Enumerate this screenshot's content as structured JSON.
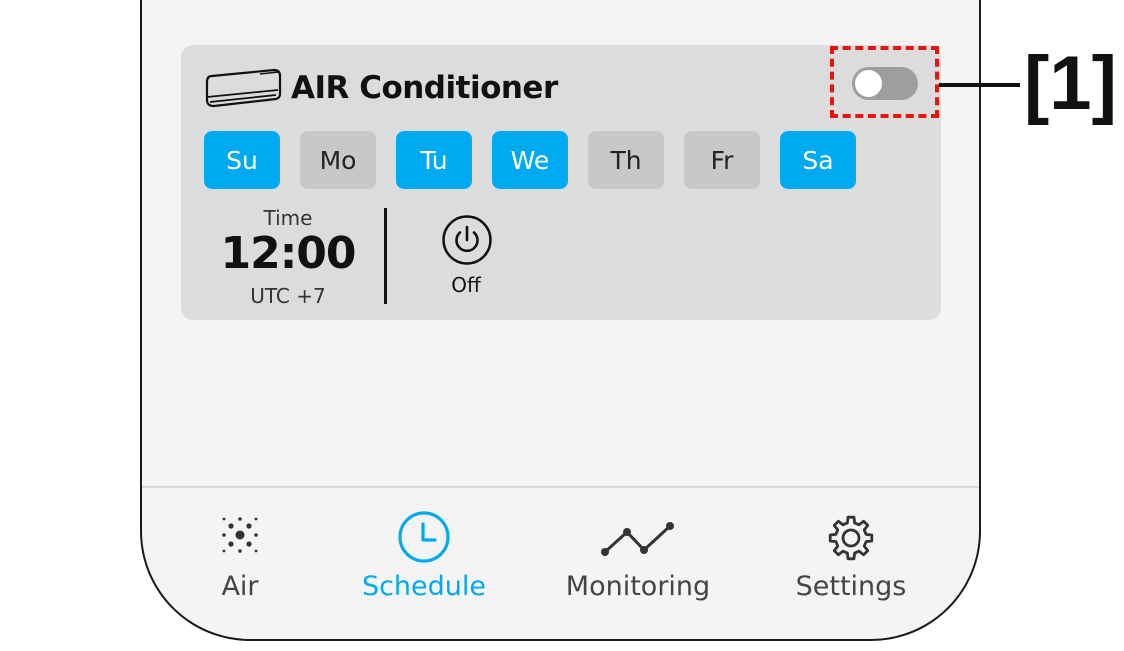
{
  "card": {
    "title": "AIR Conditioner",
    "toggle_state": "off",
    "icon": "air-conditioner-icon"
  },
  "callout": {
    "label": "[1]"
  },
  "days": [
    {
      "label": "Su",
      "active": true
    },
    {
      "label": "Mo",
      "active": false
    },
    {
      "label": "Tu",
      "active": true
    },
    {
      "label": "We",
      "active": true
    },
    {
      "label": "Th",
      "active": false
    },
    {
      "label": "Fr",
      "active": false
    },
    {
      "label": "Sa",
      "active": true
    }
  ],
  "schedule": {
    "time_label": "Time",
    "time_value": "12:00",
    "timezone": "UTC +7",
    "action_label": "Off",
    "action_icon": "power-icon"
  },
  "nav": {
    "items": [
      {
        "label": "Air",
        "icon": "air-particles-icon",
        "active": false
      },
      {
        "label": "Schedule",
        "icon": "clock-icon",
        "active": true
      },
      {
        "label": "Monitoring",
        "icon": "line-chart-icon",
        "active": false
      },
      {
        "label": "Settings",
        "icon": "gear-icon",
        "active": false
      }
    ]
  },
  "colors": {
    "accent": "#00aaf0",
    "card_bg": "#dcdcdd",
    "chip_inactive": "#c8c8c9",
    "highlight": "#e8150f",
    "toggle_off": "#9e9e9e"
  }
}
